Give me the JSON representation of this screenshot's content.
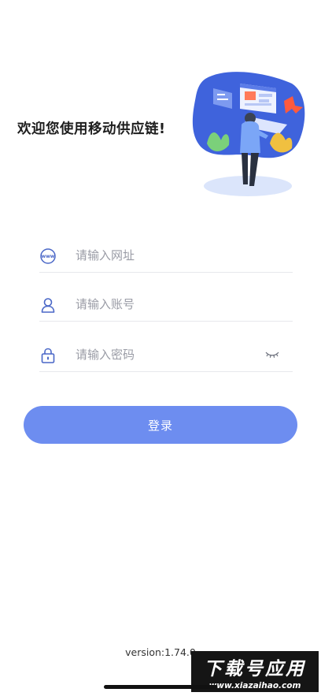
{
  "header": {
    "welcome_text": "欢迎您使用移动供应链!"
  },
  "form": {
    "url_placeholder": "请输入网址",
    "url_icon_text": "www",
    "account_placeholder": "请输入账号",
    "password_placeholder": "请输入密码",
    "login_label": "登录"
  },
  "footer": {
    "version_text": "version:1.74.0"
  },
  "watermark": {
    "title": "下载号应用",
    "site": "www.xiazaihao.com"
  },
  "icons": {
    "url": "www-globe-icon",
    "account": "user-icon",
    "password": "lock-icon",
    "toggle_password": "eye-closed-icon"
  },
  "colors": {
    "accent": "#6d8df0",
    "icon": "#4a67c7",
    "placeholder": "#9a9ca6",
    "divider": "#e7e8ec",
    "hero_blob": "#3f63dc"
  }
}
